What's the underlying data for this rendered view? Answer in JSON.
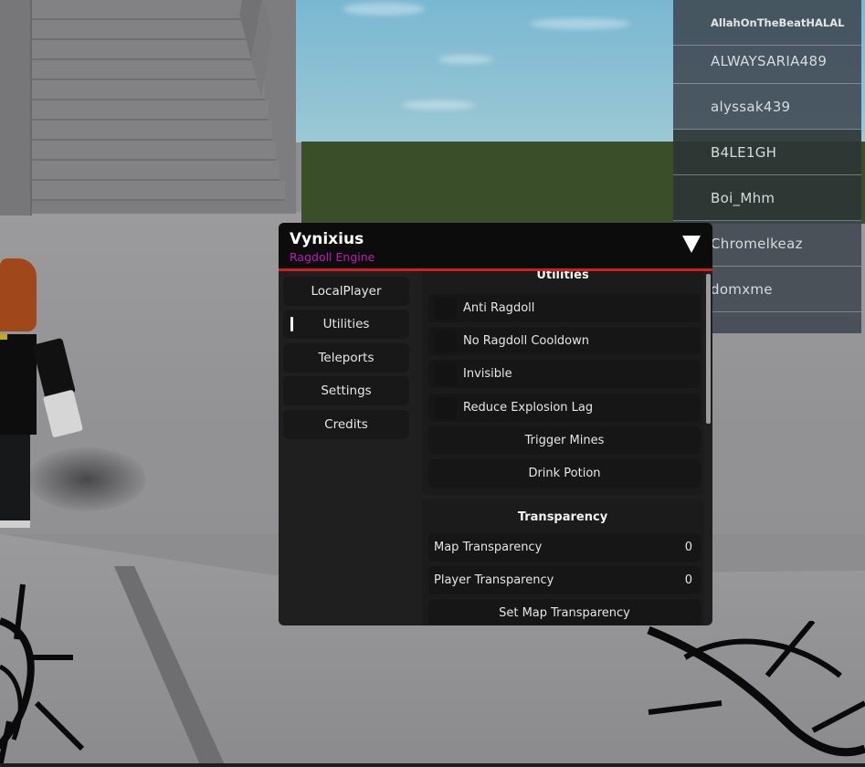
{
  "window": {
    "title": "Vynixius",
    "subtitle": "Ragdoll Engine",
    "collapse_icon": "triangle-down-icon",
    "colors": {
      "accent_line": "#cf1f1f",
      "subtitle": "#c21ab8",
      "background": "#1f1f1f",
      "titlebar": "#0c0c0c"
    }
  },
  "tabs": [
    {
      "label": "LocalPlayer",
      "active": false
    },
    {
      "label": "Utilities",
      "active": true
    },
    {
      "label": "Teleports",
      "active": false
    },
    {
      "label": "Settings",
      "active": false
    },
    {
      "label": "Credits",
      "active": false
    }
  ],
  "sections": {
    "utilities": {
      "title": "Utilities",
      "toggles": [
        {
          "label": "Anti Ragdoll",
          "enabled": false
        },
        {
          "label": "No Ragdoll Cooldown",
          "enabled": false
        },
        {
          "label": "Invisible",
          "enabled": false
        },
        {
          "label": "Reduce Explosion Lag",
          "enabled": false
        }
      ],
      "buttons": [
        {
          "label": "Trigger Mines"
        },
        {
          "label": "Drink Potion"
        }
      ]
    },
    "transparency": {
      "title": "Transparency",
      "sliders": [
        {
          "label": "Map Transparency",
          "value": "0"
        },
        {
          "label": "Player Transparency",
          "value": "0"
        }
      ],
      "buttons": [
        {
          "label": "Set Map Transparency"
        }
      ]
    }
  },
  "playerlist": {
    "players": [
      "AllahOnTheBeatHALAL",
      "ALWAYSARIA489",
      "alyssak439",
      "B4LE1GH",
      "Boi_Mhm",
      "Chromelkeaz",
      "domxme",
      ""
    ]
  }
}
